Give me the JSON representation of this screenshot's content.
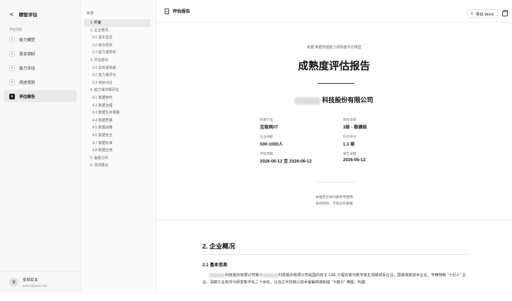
{
  "sidebar": {
    "back_glyph": "<",
    "app_title": "精智评估",
    "section_label": "评估流程",
    "steps": [
      {
        "num": "1",
        "label": "能力模型"
      },
      {
        "num": "2",
        "label": "现状调研"
      },
      {
        "num": "3",
        "label": "能力评估"
      },
      {
        "num": "4",
        "label": "改进规划"
      },
      {
        "num": "5",
        "label": "评估报告",
        "active": true
      }
    ],
    "user": {
      "avatar": "安",
      "name": "安世亚太",
      "email": "admin@pera.com"
    }
  },
  "toc": {
    "title": "目录",
    "items": [
      {
        "label": "1. 封面",
        "active": true
      },
      {
        "label": "2. 企业概况"
      },
      {
        "label": "2.1 基本信息",
        "sub": true
      },
      {
        "label": "2.2 综合现状",
        "sub": true
      },
      {
        "label": "2.3 能力域现状",
        "sub": true
      },
      {
        "label": "3. 评估结论"
      },
      {
        "label": "3.1 总体成熟度",
        "sub": true
      },
      {
        "label": "3.2 能力域评分",
        "sub": true
      },
      {
        "label": "3.3 目标对比",
        "sub": true
      },
      {
        "label": "4. 能力域详细评估"
      },
      {
        "label": "4.1 数据架构",
        "sub": true
      },
      {
        "label": "4.2 数据治理",
        "sub": true
      },
      {
        "label": "4.3 数据生存周期",
        "sub": true
      },
      {
        "label": "4.4 数据质量",
        "sub": true
      },
      {
        "label": "4.5 数据战略",
        "sub": true
      },
      {
        "label": "4.6 数据安全",
        "sub": true
      },
      {
        "label": "4.7 数据标准",
        "sub": true
      },
      {
        "label": "4.8 数据应用",
        "sub": true
      },
      {
        "label": "5. 差距分析"
      },
      {
        "label": "6. 改进建议"
      }
    ]
  },
  "topbar": {
    "title": "评估报告",
    "export_icon": "download-icon",
    "export_label": "导出 Word",
    "print_icon": "printer-icon"
  },
  "cover": {
    "subtitle": "依据 数据管理能力成熟度评估模型",
    "title": "成熟度评估报告",
    "company_suffix": "科技股份有限公司",
    "fields": [
      {
        "label": "所属行业",
        "value": "互联网/IT"
      },
      {
        "label": "目标等级",
        "value": "3级 - 稳健级"
      },
      {
        "label": "企业规模",
        "value": "500-1000人"
      },
      {
        "label": "综合评分",
        "value": "1.3 级"
      },
      {
        "label": "评估周期",
        "value": "2026-06-12 至 2026-06-12"
      },
      {
        "label": "报告日期",
        "value": "2026-06-12"
      }
    ],
    "note_line1": "本报告仅供内部参考使用",
    "note_line2": "未经授权，不得对外披露"
  },
  "section2": {
    "title": "2. 企业概况",
    "sub_title": "2.1 基本信息",
    "para_part1": "科技股份有限公司简介",
    "para_part2": "科技股份有限公司是国内自主 CAE 工程仿真与数字孪生领域领军企业，国家高新技术企业、专精特新 \"小巨人\" 企业、深耕工业软件与研发数字化二十余年，以自主可控核心技术破解高端制造 \"卡脖子\" 难题，构建"
  }
}
